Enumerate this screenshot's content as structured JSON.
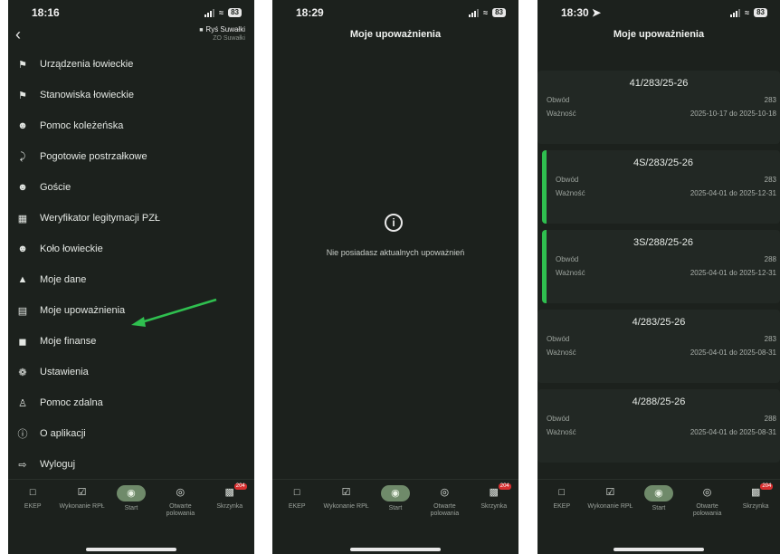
{
  "colors": {
    "background": "#1c211d",
    "card": "#222824",
    "accent": "#2fbf4f",
    "badge": "#d62f2f",
    "arrow": "#2fbf4f"
  },
  "screen1": {
    "time": "18:16",
    "battery": "83",
    "club_name": "Ryś Suwałki",
    "club_sub": "ZO Suwałki",
    "menu": [
      {
        "label": "Urządzenia łowieckie",
        "icon": "hunting-stand-icon"
      },
      {
        "label": "Stanowiska łowieckie",
        "icon": "flag-icon"
      },
      {
        "label": "Pomoc koleżeńska",
        "icon": "people-icon"
      },
      {
        "label": "Pogotowie postrzałkowe",
        "icon": "dog-icon"
      },
      {
        "label": "Goście",
        "icon": "guests-icon"
      },
      {
        "label": "Weryfikator legitymacji PZŁ",
        "icon": "qr-scan-icon"
      },
      {
        "label": "Koło łowieckie",
        "icon": "club-icon"
      },
      {
        "label": "Moje dane",
        "icon": "person-icon"
      },
      {
        "label": "Moje upoważnienia",
        "icon": "document-icon"
      },
      {
        "label": "Moje finanse",
        "icon": "wallet-icon"
      },
      {
        "label": "Ustawienia",
        "icon": "gear-icon"
      },
      {
        "label": "Pomoc zdalna",
        "icon": "remote-help-icon"
      },
      {
        "label": "O aplikacji",
        "icon": "info-icon"
      },
      {
        "label": "Wyloguj",
        "icon": "logout-icon"
      }
    ]
  },
  "screen2": {
    "time": "18:29",
    "battery": "83",
    "title": "Moje upoważnienia",
    "empty_message": "Nie posiadasz aktualnych upoważnień"
  },
  "screen3": {
    "time": "18:30",
    "battery": "83",
    "title": "Moje upoważnienia",
    "field_obwod": "Obwód",
    "field_waznosc": "Ważność",
    "cards": [
      {
        "code": "41/283/25-26",
        "obwod": "283",
        "waznosc": "2025-10-17 do 2025-10-18",
        "active": false
      },
      {
        "code": "4S/283/25-26",
        "obwod": "283",
        "waznosc": "2025-04-01 do 2025-12-31",
        "active": true
      },
      {
        "code": "3S/288/25-26",
        "obwod": "288",
        "waznosc": "2025-04-01 do 2025-12-31",
        "active": true
      },
      {
        "code": "4/283/25-26",
        "obwod": "283",
        "waznosc": "2025-04-01 do 2025-08-31",
        "active": false
      },
      {
        "code": "4/288/25-26",
        "obwod": "288",
        "waznosc": "2025-04-01 do 2025-08-31",
        "active": false
      }
    ]
  },
  "tabbar": {
    "tabs": [
      {
        "label": "EKEP",
        "icon": "ekep-icon"
      },
      {
        "label": "Wykonanie RPŁ",
        "icon": "calendar-check-icon"
      },
      {
        "label": "Start",
        "icon": "home-badge-icon"
      },
      {
        "label": "Otwarte polowania",
        "icon": "target-icon"
      },
      {
        "label": "Skrzynka",
        "icon": "inbox-icon",
        "badge": "204"
      }
    ]
  }
}
